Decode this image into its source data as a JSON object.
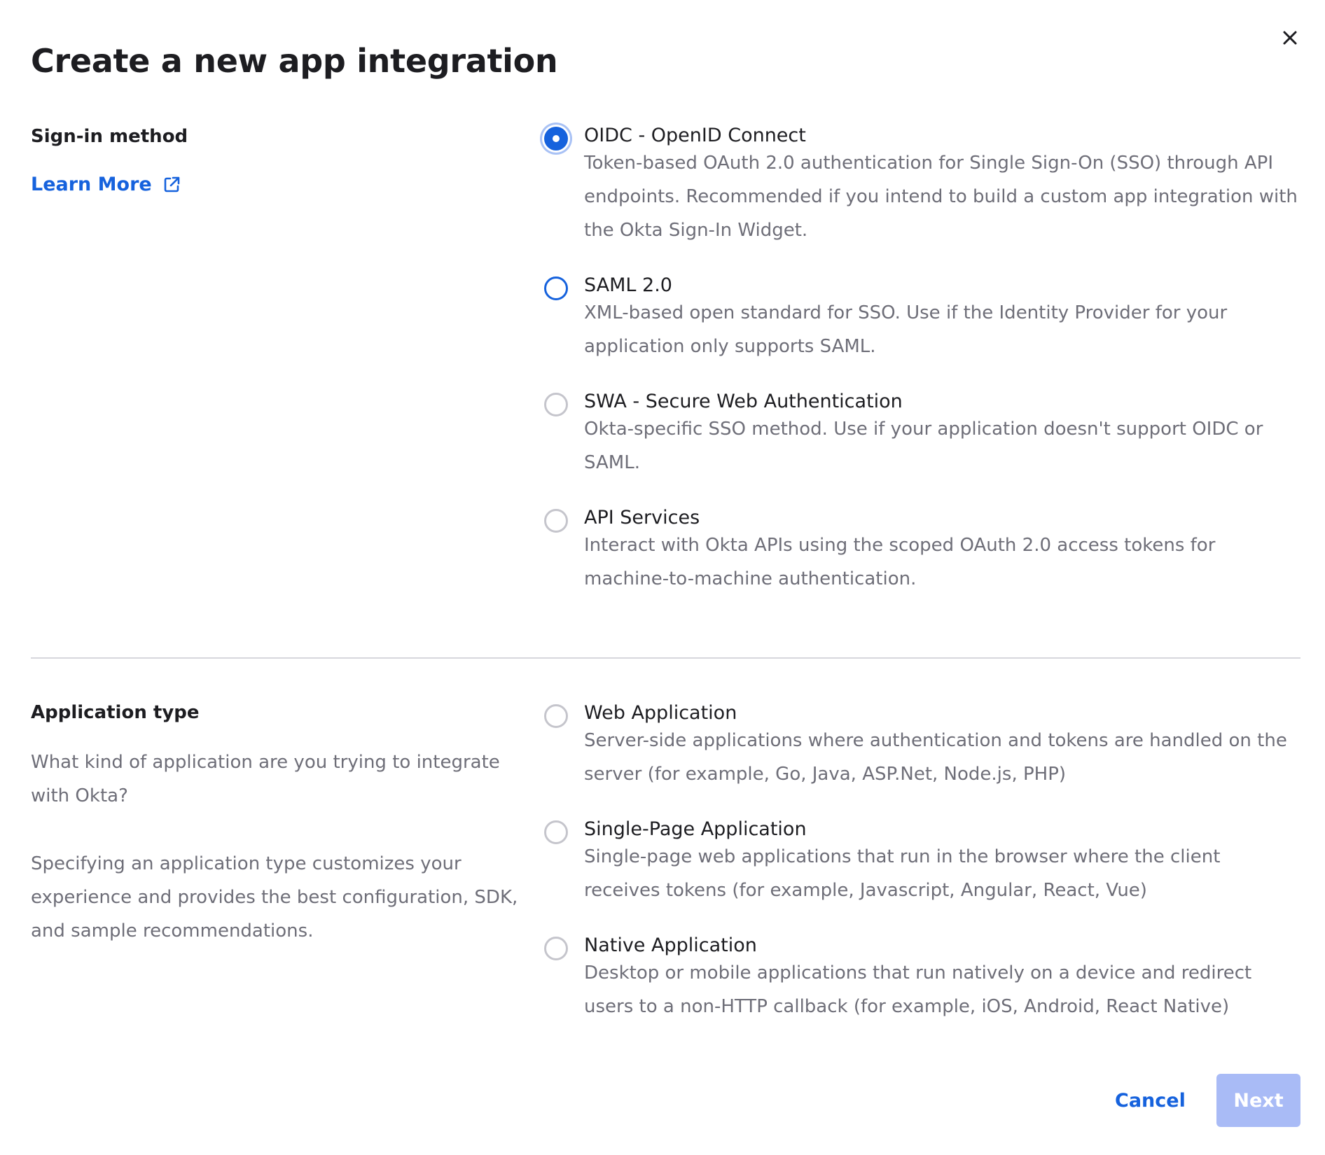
{
  "dialog": {
    "title": "Create a new app integration"
  },
  "sign_in_section": {
    "label": "Sign-in method",
    "learn_more": "Learn More",
    "options": [
      {
        "label": "OIDC - OpenID Connect",
        "description": "Token-based OAuth 2.0 authentication for Single Sign-On (SSO) through API endpoints. Recommended if you intend to build a custom app integration with the Okta Sign-In Widget.",
        "checked": true
      },
      {
        "label": "SAML 2.0",
        "description": "XML-based open standard for SSO. Use if the Identity Provider for your application only supports SAML.",
        "checked": false
      },
      {
        "label": "SWA - Secure Web Authentication",
        "description": "Okta-specific SSO method. Use if your application doesn't support OIDC or SAML.",
        "checked": false
      },
      {
        "label": "API Services",
        "description": "Interact with Okta APIs using the scoped OAuth 2.0 access tokens for machine-to-machine authentication.",
        "checked": false
      }
    ]
  },
  "app_type_section": {
    "label": "Application type",
    "question": "What kind of application are you trying to integrate with Okta?",
    "help": "Specifying an application type customizes your experience and provides the best configuration, SDK, and sample recommendations.",
    "options": [
      {
        "label": "Web Application",
        "description": "Server-side applications where authentication and tokens are handled on the server (for example, Go, Java, ASP.Net, Node.js, PHP)",
        "checked": false
      },
      {
        "label": "Single-Page Application",
        "description": "Single-page web applications that run in the browser where the client receives tokens (for example, Javascript, Angular, React, Vue)",
        "checked": false
      },
      {
        "label": "Native Application",
        "description": "Desktop or mobile applications that run natively on a device and redirect users to a non-HTTP callback (for example, iOS, Android, React Native)",
        "checked": false
      }
    ]
  },
  "footer": {
    "cancel_label": "Cancel",
    "next_label": "Next",
    "next_disabled": true
  },
  "icons": {
    "close": "close-icon",
    "external_link": "external-link-icon"
  },
  "colors": {
    "accent": "#1662dd",
    "next_disabled_bg": "#a9bbf6",
    "muted_text": "#6e6e78",
    "divider": "#d7d7dc"
  }
}
